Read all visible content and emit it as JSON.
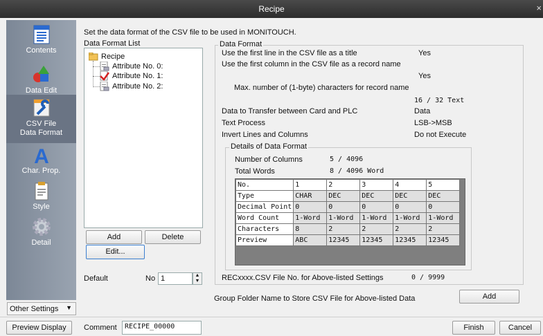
{
  "window": {
    "title": "Recipe"
  },
  "sidebar": {
    "items": [
      {
        "label": "Contents",
        "icon": "contents-icon"
      },
      {
        "label": "Data Edit",
        "icon": "data-edit-icon"
      },
      {
        "label": "CSV File\nData Format",
        "icon": "csv-wrench-icon"
      },
      {
        "label": "Char. Prop.",
        "icon": "char-prop-icon"
      },
      {
        "label": "Style",
        "icon": "style-icon"
      },
      {
        "label": "Detail",
        "icon": "gear-icon"
      }
    ],
    "other_settings": "Other Settings"
  },
  "header": {
    "instruction": "Set the data format of the CSV file to be used in MONITOUCH."
  },
  "format_list": {
    "label": "Data Format List",
    "root": "Recipe",
    "items": [
      "Attribute No. 0:",
      "Attribute No. 1:",
      "Attribute No. 2:"
    ],
    "add": "Add",
    "delete": "Delete",
    "edit": "Edit...",
    "default_label": "Default",
    "no_label": "No",
    "no_value": "1"
  },
  "data_format": {
    "group_label": "Data Format",
    "rows": [
      {
        "label": "Use the first line in the CSV file as a title",
        "value": "Yes"
      },
      {
        "label": "Use the first column in the CSV file as a record name",
        "value": "Yes"
      },
      {
        "label": "Max. number of (1-byte) characters for record name",
        "value": "16 / 32 Text"
      },
      {
        "label": "Data to Transfer between Card and PLC",
        "value": "Data"
      },
      {
        "label": "Text Process",
        "value": "LSB->MSB"
      },
      {
        "label": "Invert Lines and Columns",
        "value": "Do not Execute"
      }
    ],
    "details": {
      "group_label": "Details of Data Format",
      "columns_label": "Number of Columns",
      "columns_value": "5 / 4096",
      "words_label": "Total Words",
      "words_value": "8 / 4096 Word"
    },
    "grid": {
      "header": [
        "No.",
        "1",
        "2",
        "3",
        "4",
        "5"
      ],
      "rows": [
        [
          "Type",
          "CHAR",
          "DEC",
          "DEC",
          "DEC",
          "DEC"
        ],
        [
          "Decimal Point",
          "0",
          "0",
          "0",
          "0",
          "0"
        ],
        [
          "Word Count",
          "1-Word",
          "1-Word",
          "1-Word",
          "1-Word",
          "1-Word"
        ],
        [
          "Characters",
          "8",
          "2",
          "2",
          "2",
          "2"
        ],
        [
          "Preview",
          "ABC",
          "12345",
          "12345",
          "12345",
          "12345"
        ]
      ]
    },
    "csv_no_label": "RECxxxx.CSV File No. for Above-listed Settings",
    "csv_no_value": "0 / 9999"
  },
  "footer": {
    "group_folder_label": "Group Folder Name to Store CSV File for Above-listed Data",
    "add": "Add",
    "preview_display": "Preview Display",
    "comment_label": "Comment",
    "comment_value": "RECIPE_00000",
    "finish": "Finish",
    "cancel": "Cancel"
  }
}
